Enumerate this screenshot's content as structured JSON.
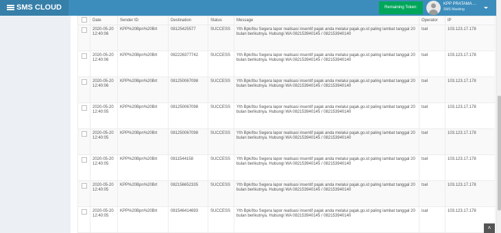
{
  "header": {
    "brand": "SMS CLOUD",
    "remaining_token_label": "Remaining Token:",
    "user_name": "KPP PRATAMA ...",
    "user_role": "SMS Masking"
  },
  "table": {
    "columns": [
      "Date",
      "Sender ID",
      "Destination",
      "Status",
      "Message",
      "Operator",
      "IP"
    ],
    "rows": [
      {
        "date": "2020-05-20 12:40:06",
        "sender": "KPP%20Bpn%20Brt",
        "destination": "08125425577",
        "status": "SUCCESS",
        "message": "Yth Bpk/Ibu Segera lapor realisasi insentif pajak anda melalui pajak.go.id paling lambat tanggal 20 bulan berikutnya. Hubungi WA 082153940145 / 082153940140",
        "operator": "tsel",
        "ip": "103.123.17.178"
      },
      {
        "date": "2020-05-20 12:40:06",
        "sender": "KPP%20Bpn%20Brt",
        "destination": "082226377742",
        "status": "SUCCESS",
        "message": "Yth Bpk/Ibu Segera lapor realisasi insentif pajak anda melalui pajak.go.id paling lambat tanggal 20 bulan berikutnya. Hubungi WA 082153940145 / 082153940140",
        "operator": "tsel",
        "ip": "103.123.17.178"
      },
      {
        "date": "2020-05-20 12:40:06",
        "sender": "KPP%20Bpn%20Brt",
        "destination": "081250067098",
        "status": "SUCCESS",
        "message": "Yth Bpk/Ibu Segera lapor realisasi insentif pajak anda melalui pajak.go.id paling lambat tanggal 20 bulan berikutnya. Hubungi WA 082153940145 / 082153940140",
        "operator": "tsel",
        "ip": "103.123.17.178"
      },
      {
        "date": "2020-05-20 12:40:05",
        "sender": "KPP%20Bpn%20Brt",
        "destination": "081250067098",
        "status": "SUCCESS",
        "message": "Yth Bpk/Ibu Segera lapor realisasi insentif pajak anda melalui pajak.go.id paling lambat tanggal 20 bulan berikutnya. Hubungi WA 082153940145 / 082153940140",
        "operator": "tsel",
        "ip": "103.123.17.178"
      },
      {
        "date": "2020-05-20 12:40:05",
        "sender": "KPP%20Bpn%20Brt",
        "destination": "081250067098",
        "status": "SUCCESS",
        "message": "Yth Bpk/Ibu Segera lapor realisasi insentif pajak anda melalui pajak.go.id paling lambat tanggal 20 bulan berikutnya. Hubungi WA 082153940145 / 082153940140",
        "operator": "tsel",
        "ip": "103.123.17.178"
      },
      {
        "date": "2020-05-20 12:40:05",
        "sender": "KPP%20Bpn%20Brt",
        "destination": "0811544158",
        "status": "SUCCESS",
        "message": "Yth Bpk/Ibu Segera lapor realisasi insentif pajak anda melalui pajak.go.id paling lambat tanggal 20 bulan berikutnya. Hubungi WA 082153940145 / 082153940140",
        "operator": "tsel",
        "ip": "103.123.17.178"
      },
      {
        "date": "2020-05-20 12:40:05",
        "sender": "KPP%20Bpn%20Brt",
        "destination": "082156652335",
        "status": "SUCCESS",
        "message": "Yth Bpk/Ibu Segera lapor realisasi insentif pajak anda melalui pajak.go.id paling lambat tanggal 20 bulan berikutnya. Hubungi WA 082153940145 / 082153940140",
        "operator": "tsel",
        "ip": "103.123.17.178"
      },
      {
        "date": "2020-05-20 12:40:05",
        "sender": "KPP%20Bpn%20Brt",
        "destination": "081546414693",
        "status": "SUCCESS",
        "message": "Yth Bpk/Ibu Segera lapor realisasi insentif pajak anda melalui pajak.go.id paling lambat tanggal 20 bulan berikutnya. Hubungi WA 082153940145 / 082153940140",
        "operator": "isat",
        "ip": "103.123.17.178"
      }
    ]
  },
  "icons": {
    "menu": "menu-icon",
    "avatar": "user-avatar-icon",
    "dropdown": "caret-down-icon",
    "scroll_top": "chevron-up-icon"
  },
  "colors": {
    "header": "#3c8dbc",
    "brand": "#367fa9",
    "token_badge": "#00a65a",
    "sidebar_bg": "#ecf0f5"
  }
}
